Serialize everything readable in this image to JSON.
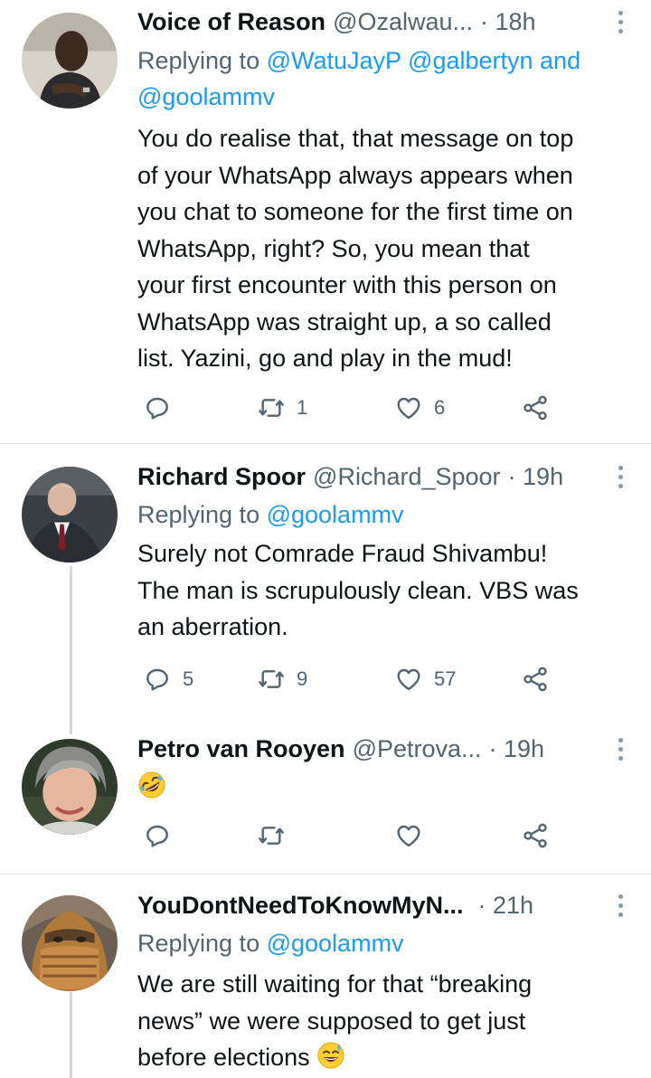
{
  "tweets": [
    {
      "name": "Voice of Reason",
      "handle": "@Ozalwau...",
      "time": "· 18h",
      "reply_prefix": "Replying to ",
      "reply_handles": "@WatuJayP @galbertyn and",
      "reply_handles_line2": "@goolammv",
      "lines": [
        "You do realise that, that message on top",
        "of your WhatsApp always appears when",
        "you chat to someone for the first time on",
        "WhatsApp, right? So, you mean that",
        "your first encounter with this person on",
        "WhatsApp was straight up, a so called",
        "list. Yazini, go and play in the mud!"
      ],
      "replies": "",
      "retweets": "1",
      "likes": "6"
    },
    {
      "name": "Richard Spoor",
      "handle": "@Richard_Spoor",
      "time": "· 19h",
      "reply_prefix": "Replying to ",
      "reply_handles": "@goolammv",
      "lines": [
        "Surely not Comrade Fraud Shivambu!",
        "The man is scrupulously clean. VBS was",
        "an aberration."
      ],
      "replies": "5",
      "retweets": "9",
      "likes": "57"
    },
    {
      "name": "Petro van Rooyen",
      "handle": "@Petrova...",
      "time": "· 19h",
      "emoji": "rolling-on-floor-laughing-emoji",
      "replies": "",
      "retweets": "",
      "likes": ""
    },
    {
      "name": "YouDontNeedToKnowMyN...",
      "handle": "",
      "time": "· 21h",
      "reply_prefix": "Replying to ",
      "reply_handles": "@goolammv",
      "lines": [
        "We are still waiting for that “breaking",
        "news” we were supposed to get just",
        "before elections"
      ],
      "trailing_emoji": "grinning-sweat-emoji"
    }
  ],
  "colors": {
    "text": "#0f1419",
    "secondary": "#536471",
    "link": "#1d9bf0",
    "divider": "#dfe3e6",
    "thread_line": "#cfd9de"
  },
  "icons": {
    "reply": "reply-icon",
    "retweet": "retweet-icon",
    "like": "heart-icon",
    "share": "share-icon",
    "more": "more-options-icon"
  }
}
